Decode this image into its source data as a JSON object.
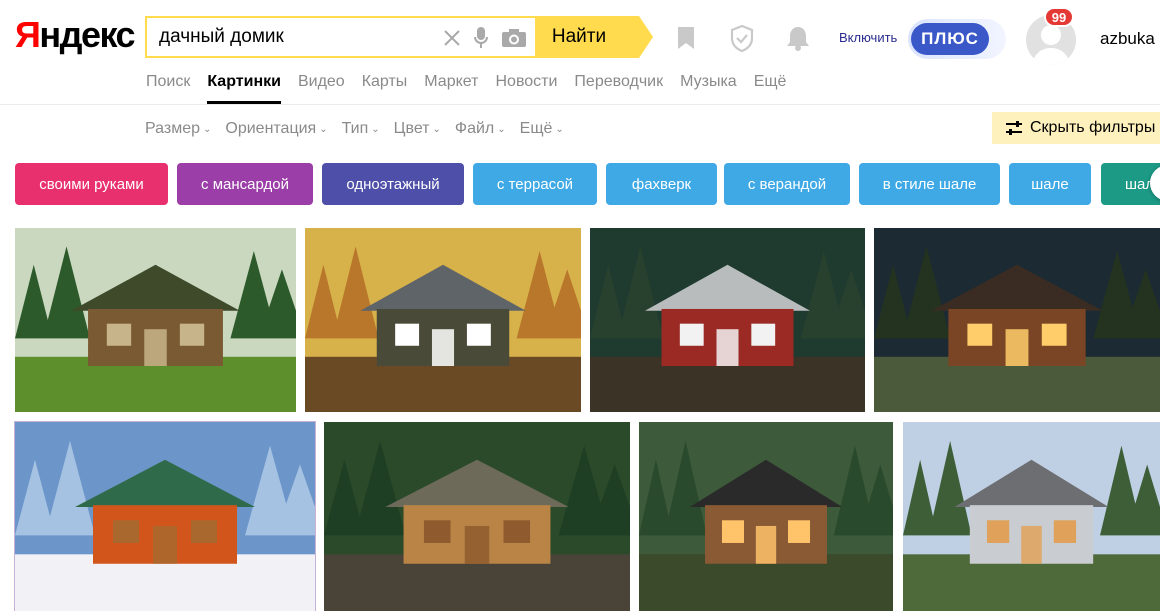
{
  "logo": {
    "first_letter": "Я",
    "rest": "ндекс"
  },
  "search": {
    "query": "дачный домик",
    "button_label": "Найти"
  },
  "header": {
    "plus_link": "Включить",
    "plus_label": "ПЛЮС",
    "notifications_count": "99",
    "username": "azbuka"
  },
  "services": [
    {
      "label": "Поиск"
    },
    {
      "label": "Картинки",
      "active": true
    },
    {
      "label": "Видео"
    },
    {
      "label": "Карты"
    },
    {
      "label": "Маркет"
    },
    {
      "label": "Новости"
    },
    {
      "label": "Переводчик"
    },
    {
      "label": "Музыка"
    },
    {
      "label": "Ещё"
    }
  ],
  "filters": {
    "items": [
      {
        "label": "Размер"
      },
      {
        "label": "Ориентация"
      },
      {
        "label": "Тип"
      },
      {
        "label": "Цвет"
      },
      {
        "label": "Файл"
      },
      {
        "label": "Ещё"
      }
    ],
    "hide_label": "Скрыть фильтры"
  },
  "tags": [
    {
      "label": "своими руками",
      "color": "#e8306f"
    },
    {
      "label": "с мансардой",
      "color": "#9b3ea8"
    },
    {
      "label": "одноэтажный",
      "color": "#4e4fa8"
    },
    {
      "label": "с террасой",
      "color": "#3fa9e6"
    },
    {
      "label": "фахверк",
      "color": "#3fa9e6"
    },
    {
      "label": "с верандой",
      "color": "#3fa9e6"
    },
    {
      "label": "в стиле шале",
      "color": "#3fa9e6"
    },
    {
      "label": "шале",
      "color": "#3fa9e6"
    },
    {
      "label": "шале",
      "color": "#1c9a86"
    }
  ],
  "images": [
    {
      "sky": "#c9d8bf",
      "ground": "#5e8f2d",
      "trees": "#2d5a2a",
      "wall": "#7a5a33",
      "roof": "#3e4a2a",
      "trim": "#c8b48a"
    },
    {
      "sky": "#d7b14a",
      "ground": "#6a4a25",
      "trees": "#b8772a",
      "wall": "#4a4a38",
      "roof": "#5f6468",
      "trim": "#ffffff"
    },
    {
      "sky": "#1f3a2f",
      "ground": "#3b3326",
      "trees": "#28402e",
      "wall": "#9b2a25",
      "roof": "#b9bcbd",
      "trim": "#f2f2f2"
    },
    {
      "sky": "#1c2a33",
      "ground": "#4a5a3a",
      "trees": "#23331f",
      "wall": "#7a4525",
      "roof": "#3a2c22",
      "trim": "#ffce6a"
    },
    {
      "sky": "#6c95c9",
      "ground": "#f1f1f6",
      "trees": "#a5c2e3",
      "wall": "#d2561c",
      "roof": "#2f6b4a",
      "trim": "#a9682e"
    },
    {
      "sky": "#2a4a2a",
      "ground": "#4a4438",
      "trees": "#1f3f24",
      "wall": "#b98446",
      "roof": "#6e6a5a",
      "trim": "#8f5a2e"
    },
    {
      "sky": "#3d5a3a",
      "ground": "#3a4a2a",
      "trees": "#294a2c",
      "wall": "#8a5a35",
      "roof": "#2a2a2a",
      "trim": "#ffc36a"
    },
    {
      "sky": "#bfd0e4",
      "ground": "#4f6a3a",
      "trees": "#3d5e36",
      "wall": "#c9ccd0",
      "roof": "#6d6e72",
      "trim": "#e0a25a"
    }
  ]
}
